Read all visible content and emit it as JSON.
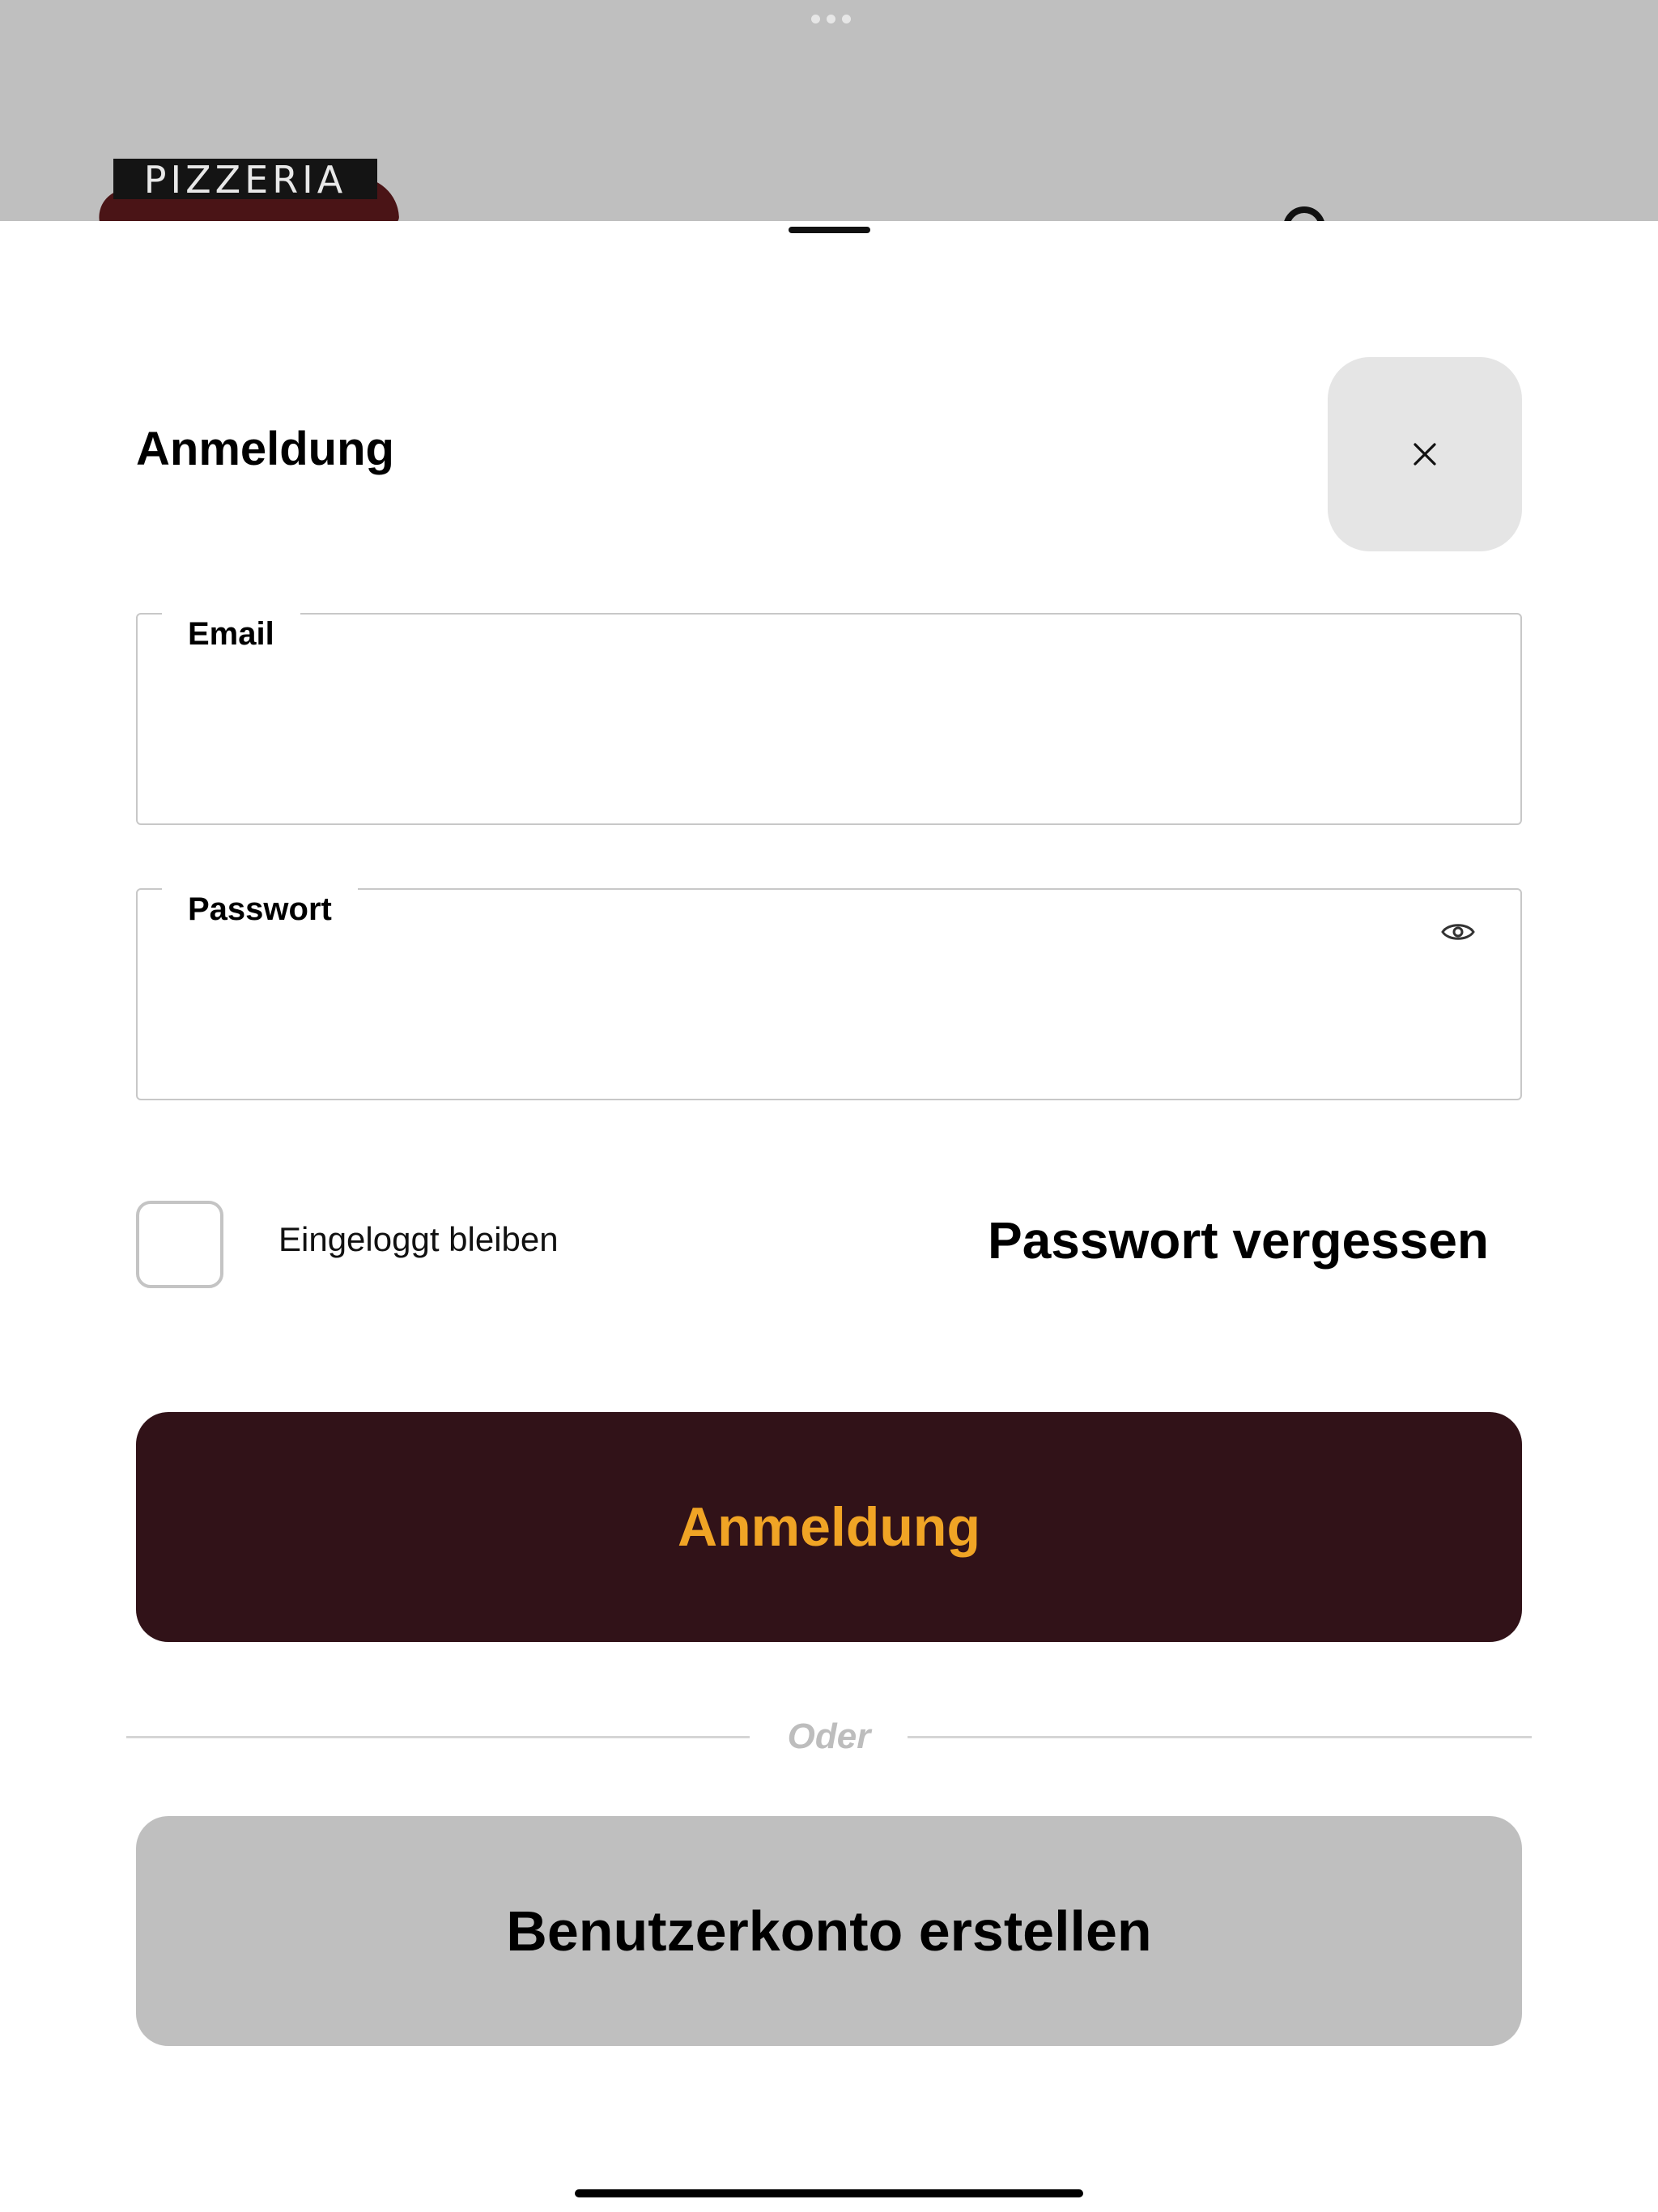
{
  "background_page": {
    "logo_text": "PIZZERIA"
  },
  "sheet": {
    "title": "Anmeldung",
    "close_icon": "close-icon",
    "email": {
      "label": "Email",
      "value": ""
    },
    "password": {
      "label": "Passwort",
      "value": "",
      "toggle_icon": "eye-icon"
    },
    "remember": {
      "label": "Eingeloggt bleiben",
      "checked": false
    },
    "forgot_label": "Passwort vergessen",
    "login_button_label": "Anmeldung",
    "divider_text": "Oder",
    "register_button_label": "Benutzerkonto erstellen"
  },
  "colors": {
    "primary_button_bg": "#311218",
    "primary_button_text": "#f0a425",
    "secondary_button_bg": "#bfbfbf",
    "backdrop": "#bfbfbf"
  }
}
